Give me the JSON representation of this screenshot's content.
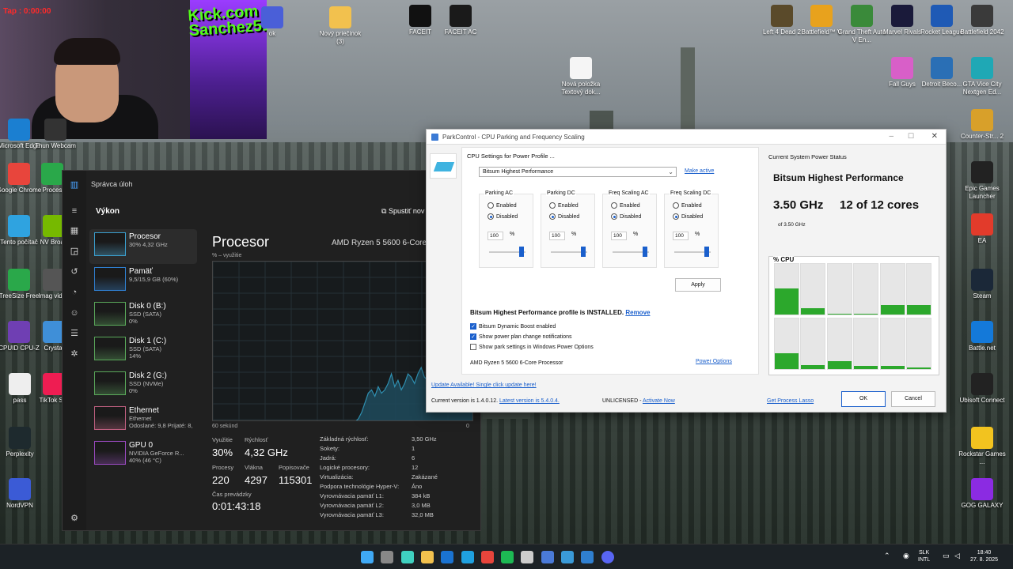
{
  "colors": {
    "accent": "#1a5fcc",
    "cpu_green": "#2ca82c",
    "graph_line": "#2f8fb0"
  },
  "webcam": {
    "overlay_label": "Tap : 0:00:00",
    "brand": "Kick.com\nSanchez51"
  },
  "desktop_icons_left": [
    {
      "label": "Microsoft Edge",
      "icon": "edge-icon",
      "color": "#1b7fd1"
    },
    {
      "label": "Google Chrome",
      "icon": "chrome-icon",
      "color": "#e8453c"
    },
    {
      "label": "Tento počítač",
      "icon": "computer-icon",
      "color": "#2fa3e0"
    },
    {
      "label": "TreeSize Free",
      "icon": "treesize-icon",
      "color": "#2aa84a"
    },
    {
      "label": "CPUID CPU-Z",
      "icon": "cpuz-icon",
      "color": "#6f3fb3"
    },
    {
      "label": "pass",
      "icon": "document-icon",
      "color": "#eeeeee"
    },
    {
      "label": "Perplexity",
      "icon": "perplexity-icon",
      "color": "#1e2a2e"
    },
    {
      "label": "NordVPN",
      "icon": "nordvpn-icon",
      "color": "#3b5bd6"
    }
  ],
  "desktop_icons_left2": [
    {
      "label": "Thun Webcam",
      "icon": "webcam-icon",
      "color": "#333333"
    },
    {
      "label": "Proces",
      "icon": "process-icon",
      "color": "#2aa84a"
    },
    {
      "label": "NV Broad",
      "icon": "nvidia-icon",
      "color": "#76b900"
    },
    {
      "label": "Imag video",
      "icon": "image-icon",
      "color": "#555555"
    },
    {
      "label": "Crystal",
      "icon": "crystal-icon",
      "color": "#3f8fd8"
    },
    {
      "label": "TikTok Stu",
      "icon": "tiktok-icon",
      "color": "#ee1d52"
    }
  ],
  "desktop_icons_top": [
    {
      "label": "ok",
      "icon": "shortcut-icon",
      "color": "#4a5fd8"
    },
    {
      "label": "Nový priečinok (3)",
      "icon": "folder-icon",
      "color": "#f2c14e"
    },
    {
      "label": "FACEIT",
      "icon": "faceit-icon",
      "color": "#111111"
    },
    {
      "label": "FACEIT AC",
      "icon": "faceit-ac-icon",
      "color": "#1a1a1a"
    },
    {
      "label": "Nová položka Textový dok...",
      "icon": "text-file-icon",
      "color": "#f5f5f5"
    }
  ],
  "desktop_icons_right": [
    {
      "label": "Left 4 Dead 2",
      "icon": "l4d2-icon",
      "color": "#5a4a2a"
    },
    {
      "label": "Battlefield™ V",
      "icon": "bf5-icon",
      "color": "#e8a21d"
    },
    {
      "label": "Grand Theft Auto V En...",
      "icon": "gta-icon",
      "color": "#3a8a3a"
    },
    {
      "label": "Marvel Rivals",
      "icon": "marvel-icon",
      "color": "#1a1a3a"
    },
    {
      "label": "Rocket League",
      "icon": "rocket-icon",
      "color": "#1f5ab5"
    },
    {
      "label": "Battlefield 2042",
      "icon": "bf2042-icon",
      "color": "#3a3a3a"
    },
    {
      "label": "Fall Guys",
      "icon": "fallguys-icon",
      "color": "#d85fc8"
    },
    {
      "label": "Detroit Beco...",
      "icon": "detroit-icon",
      "color": "#2a6fb5"
    },
    {
      "label": "GTA Vice City Nextgen Ed...",
      "icon": "gtavc-icon",
      "color": "#1fa8b5"
    },
    {
      "label": "Counter-Str... 2",
      "icon": "cs2-icon",
      "color": "#d8a02a"
    },
    {
      "label": "Epic Games Launcher",
      "icon": "epic-icon",
      "color": "#222222"
    },
    {
      "label": "EA",
      "icon": "ea-icon",
      "color": "#e23b2b"
    },
    {
      "label": "Steam",
      "icon": "steam-icon",
      "color": "#1b2838"
    },
    {
      "label": "Battle.net",
      "icon": "battlenet-icon",
      "color": "#1479d9"
    },
    {
      "label": "Ubisoft Connect",
      "icon": "ubisoft-icon",
      "color": "#222222"
    },
    {
      "label": "Rockstar Games ...",
      "icon": "rockstar-icon",
      "color": "#f2c31f"
    },
    {
      "label": "GOG GALAXY",
      "icon": "gog-icon",
      "color": "#8b2be2"
    }
  ],
  "taskmgr": {
    "title": "Správca úloh",
    "section": "Výkon",
    "run_new": "Spustiť nov",
    "items": [
      {
        "name": "Procesor",
        "sub1": "30% 4,32 GHz",
        "sub2": ""
      },
      {
        "name": "Pamäť",
        "sub1": "9,5/15,9 GB (60%)",
        "sub2": ""
      },
      {
        "name": "Disk 0 (B:)",
        "sub1": "SSD (SATA)",
        "sub2": "0%"
      },
      {
        "name": "Disk 1 (C:)",
        "sub1": "SSD (SATA)",
        "sub2": "14%"
      },
      {
        "name": "Disk 2 (G:)",
        "sub1": "SSD (NVMe)",
        "sub2": "0%"
      },
      {
        "name": "Ethernet",
        "sub1": "Ethernet",
        "sub2": "Odoslané: 9,8 Prijaté: 8,"
      },
      {
        "name": "GPU 0",
        "sub1": "NVIDIA GeForce R...",
        "sub2": "40% (46 °C)"
      }
    ],
    "panel_title": "Procesor",
    "model": "AMD Ryzen 5 5600 6-Core",
    "util_label": "% – využitie",
    "axis_left": "60 sekúnd",
    "axis_right": "0",
    "graph_values": [
      0,
      0,
      0,
      0,
      0,
      0,
      0,
      0,
      0,
      0,
      0,
      0,
      0,
      0,
      0,
      0,
      0,
      0,
      0,
      0,
      0,
      0,
      0,
      0,
      0,
      0,
      0,
      0,
      0,
      0,
      0,
      0,
      0,
      0,
      0,
      0,
      0,
      0,
      0,
      0,
      0,
      0,
      0,
      0,
      2,
      6,
      12,
      18,
      20,
      16,
      22,
      18,
      20,
      24,
      30,
      22,
      26,
      20,
      24,
      30,
      28,
      24,
      30,
      34,
      28,
      26,
      38,
      30,
      40,
      28,
      32,
      36,
      30,
      44,
      32,
      26,
      30,
      28,
      32,
      30
    ],
    "stats": {
      "util_label": "Využitie",
      "util": "30%",
      "speed_label": "Rýchlosť",
      "speed": "4,32 GHz",
      "proc_label": "Procesy",
      "proc": "220",
      "threads_label": "Vlákna",
      "threads": "4297",
      "handles_label": "Popisovače",
      "handles": "115301",
      "uptime_label": "Čas prevádzky",
      "uptime": "0:01:43:18"
    },
    "details": [
      {
        "k": "Základná rýchlosť:",
        "v": "3,50 GHz"
      },
      {
        "k": "Sokety:",
        "v": "1"
      },
      {
        "k": "Jadrá:",
        "v": "6"
      },
      {
        "k": "Logické procesory:",
        "v": "12"
      },
      {
        "k": "Virtualizácia:",
        "v": "Zakázané"
      },
      {
        "k": "Podpora technológie Hyper-V:",
        "v": "Áno"
      },
      {
        "k": "Vyrovnávacia pamäť L1:",
        "v": "384 kB"
      },
      {
        "k": "Vyrovnávacia pamäť L2:",
        "v": "3,0 MB"
      },
      {
        "k": "Vyrovnávacia pamäť L3:",
        "v": "32,0 MB"
      }
    ]
  },
  "parkcontrol": {
    "title": "ParkControl - CPU Parking and Frequency Scaling",
    "cpu_settings_label": "CPU Settings for Power Profile ...",
    "profile_selected": "Bitsum Highest Performance",
    "make_active": "Make active",
    "groups": [
      {
        "title": "Parking AC",
        "enabled": "Enabled",
        "disabled": "Disabled",
        "selected": "Disabled",
        "value": "100",
        "unit": "%"
      },
      {
        "title": "Parking DC",
        "enabled": "Enabled",
        "disabled": "Disabled",
        "selected": "Disabled",
        "value": "100",
        "unit": "%"
      },
      {
        "title": "Freq Scaling AC",
        "enabled": "Enabled",
        "disabled": "Disabled",
        "selected": "Disabled",
        "value": "100",
        "unit": "%"
      },
      {
        "title": "Freq Scaling DC",
        "enabled": "Enabled",
        "disabled": "Disabled",
        "selected": "Disabled",
        "value": "100",
        "unit": "%"
      }
    ],
    "apply": "Apply",
    "installed_text": "Bitsum Highest Performance profile is INSTALLED.",
    "remove": "Remove",
    "options": [
      {
        "label": "Bitsum Dynamic Boost enabled",
        "checked": true
      },
      {
        "label": "Show power plan change notifications",
        "checked": true
      },
      {
        "label": "Show park settings in Windows Power Options",
        "checked": false
      }
    ],
    "cpu_name": "AMD Ryzen 5 5600 6-Core Processor",
    "power_options": "Power Options",
    "status_header": "Current System Power Status",
    "status_profile": "Bitsum Highest Performance",
    "ghz": "3.50 GHz",
    "cores": "12 of 12 cores",
    "base": "of 3.50 GHz",
    "cpu_label": "% CPU",
    "core_loads_top": [
      52,
      12,
      2,
      2,
      18,
      18
    ],
    "core_loads_bottom": [
      32,
      8,
      16,
      6,
      6,
      3
    ],
    "update": "Update Available! Single click update here!",
    "current_version_text": "Current version is 1.4.0.12.",
    "latest_version": "Latest version is 5.4.0.4.",
    "unlicensed": "UNLICENSED -",
    "activate": "Activate Now",
    "get_lasso": "Get Process Lasso",
    "ok": "OK",
    "cancel": "Cancel"
  },
  "taskbar": {
    "apps": [
      {
        "icon": "windows-start-icon",
        "color": "#3fa9f5"
      },
      {
        "icon": "task-view-icon",
        "color": "#888888"
      },
      {
        "icon": "app-icon",
        "color": "#3fd0c0"
      },
      {
        "icon": "file-explorer-icon",
        "color": "#f2c14e"
      },
      {
        "icon": "outlook-icon",
        "color": "#1a73d1"
      },
      {
        "icon": "edge-icon",
        "color": "#1fa1e0"
      },
      {
        "icon": "chrome-icon",
        "color": "#e8453c"
      },
      {
        "icon": "spotify-icon",
        "color": "#1db954"
      },
      {
        "icon": "obs-icon",
        "color": "#cccccc"
      },
      {
        "icon": "vehicle-icon",
        "color": "#4a7ad8"
      },
      {
        "icon": "photos-icon",
        "color": "#3a9ad8"
      },
      {
        "icon": "taskmgr-icon",
        "color": "#2f7fd0"
      },
      {
        "icon": "discord-icon",
        "color": "#5865f2"
      }
    ],
    "lang": "SLK",
    "layout": "INTL",
    "time": "18:40",
    "date": "27. 8. 2025"
  }
}
